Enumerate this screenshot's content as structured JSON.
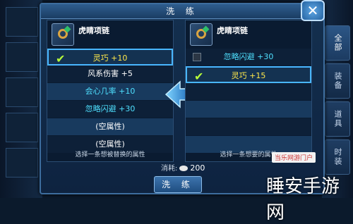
{
  "dialog": {
    "title": "洗 练",
    "close_icon": "close-icon"
  },
  "left_panel": {
    "item_name": "虎睛项链",
    "rows": [
      {
        "text": "灵巧 +10",
        "color": "#ffe84a",
        "state": "checked"
      },
      {
        "text": "风系伤害 +5",
        "color": "#ffffff",
        "state": "none"
      },
      {
        "text": "会心几率 +10",
        "color": "#4fe0ff",
        "state": "none"
      },
      {
        "text": "忽略闪避 +30",
        "color": "#4fe0ff",
        "state": "none"
      },
      {
        "text": "(空属性)",
        "color": "#ffffff",
        "state": "none"
      },
      {
        "text": "(空属性)",
        "color": "#ffffff",
        "state": "none"
      }
    ],
    "hint": "选择一条想被替换的属性"
  },
  "right_panel": {
    "item_name": "虎睛项链",
    "rows": [
      {
        "text": "忽略闪避 +30",
        "color": "#4fe0ff",
        "state": "unchecked"
      },
      {
        "text": "灵巧 +15",
        "color": "#ffe84a",
        "state": "checked"
      },
      {
        "text": "",
        "state": "none"
      },
      {
        "text": "",
        "state": "none"
      },
      {
        "text": "",
        "state": "none"
      },
      {
        "text": "",
        "state": "none"
      }
    ],
    "hint": "选择一条想要的属性"
  },
  "cost": {
    "label": "消耗:",
    "amount": "200"
  },
  "wash_button": "洗 练",
  "side_tabs": [
    "全部",
    "装备",
    "道具",
    "时装"
  ],
  "watermark": {
    "badge": "当乐网游门户",
    "text": "睡安手游网"
  }
}
